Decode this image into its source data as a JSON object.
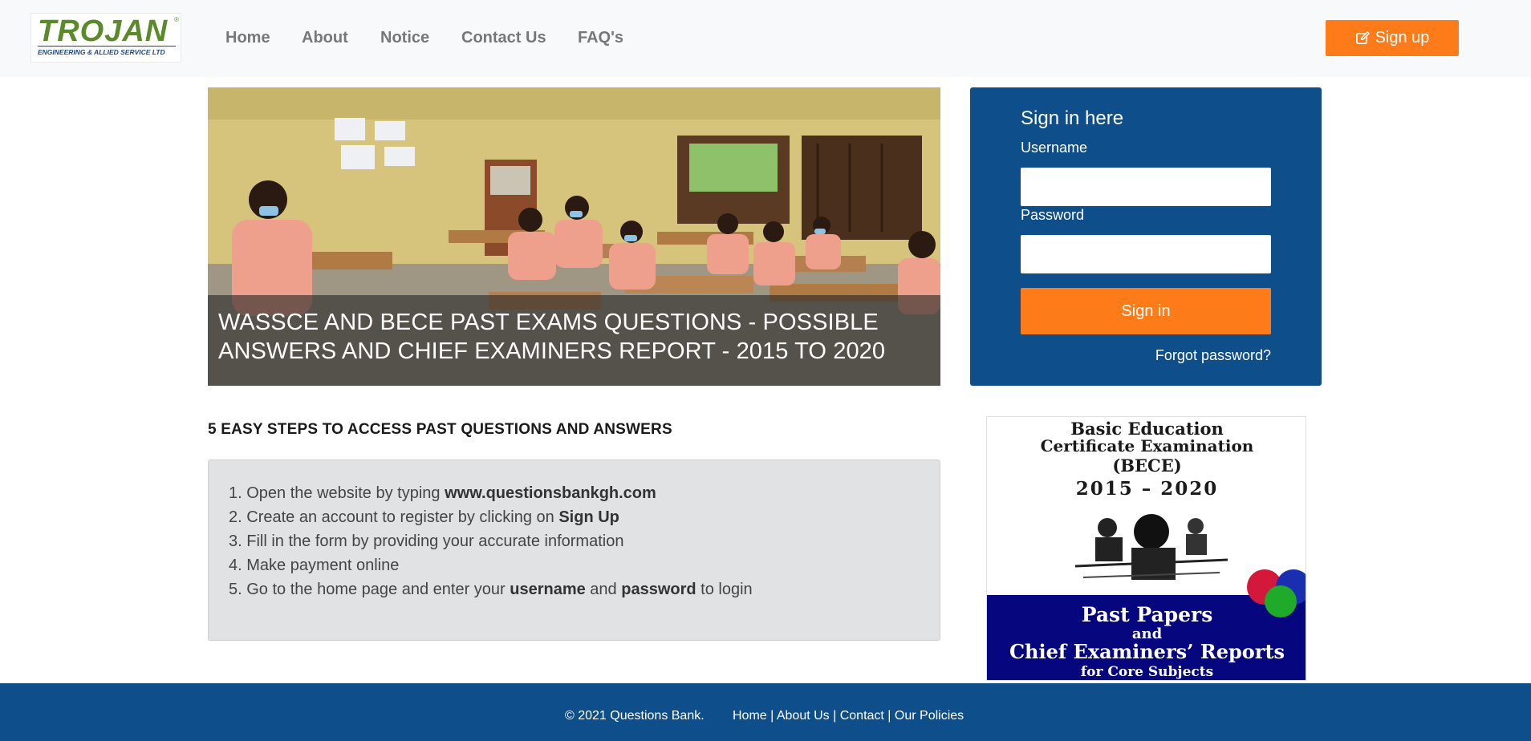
{
  "brand": {
    "logo_main": "TROJAN",
    "logo_sub": "ENGINEERING & ALLIED SERVICE LTD",
    "logo_reg": "®"
  },
  "nav": {
    "items": [
      {
        "label": "Home"
      },
      {
        "label": "About"
      },
      {
        "label": "Notice"
      },
      {
        "label": "Contact Us"
      },
      {
        "label": "FAQ's"
      }
    ],
    "signup_label": "Sign up",
    "signup_icon": "edit-icon"
  },
  "hero": {
    "caption": "WASSCE AND BECE PAST EXAMS QUESTIONS - POSSIBLE ANSWERS AND CHIEF EXAMINERS REPORT - 2015 TO 2020"
  },
  "login": {
    "title": "Sign in here",
    "username_label": "Username",
    "username_value": "",
    "password_label": "Password",
    "password_value": "",
    "signin_label": "Sign in",
    "forgot_label": "Forgot password?"
  },
  "steps": {
    "heading": "5 EASY STEPS TO ACCESS PAST QUESTIONS AND ANSWERS",
    "items": [
      {
        "num": "1.",
        "pre": "Open the website by typing ",
        "b1": "www.questionsbankgh.com",
        "mid": "",
        "b2": "",
        "post": ""
      },
      {
        "num": "2.",
        "pre": "Create an account to register by clicking on ",
        "b1": "Sign Up",
        "mid": "",
        "b2": "",
        "post": ""
      },
      {
        "num": "3.",
        "pre": "Fill in the form by providing your accurate information",
        "b1": "",
        "mid": "",
        "b2": "",
        "post": ""
      },
      {
        "num": "4.",
        "pre": "Make payment online",
        "b1": "",
        "mid": "",
        "b2": "",
        "post": ""
      },
      {
        "num": "5.",
        "pre": "Go to the home page and enter your ",
        "b1": "username",
        "mid": " and ",
        "b2": "password",
        "post": " to login"
      }
    ]
  },
  "book": {
    "line1": "Basic Education",
    "line2": "Certificate Examination",
    "line3": "(BECE)",
    "line4": "2015 – 2020",
    "bottom1": "Past Papers",
    "bottom2": "and",
    "bottom3": "Chief Examiners’ Reports",
    "bottom4": "for Core Subjects"
  },
  "footer": {
    "copyright": "© 2021 Questions Bank.",
    "links": [
      {
        "label": "Home"
      },
      {
        "label": "About Us"
      },
      {
        "label": "Contact"
      },
      {
        "label": "Our Policies"
      }
    ],
    "separator": " | "
  },
  "colors": {
    "accent_orange": "#fd7b18",
    "brand_blue": "#0d4e8b",
    "navbar_bg": "#f8f9fa"
  }
}
